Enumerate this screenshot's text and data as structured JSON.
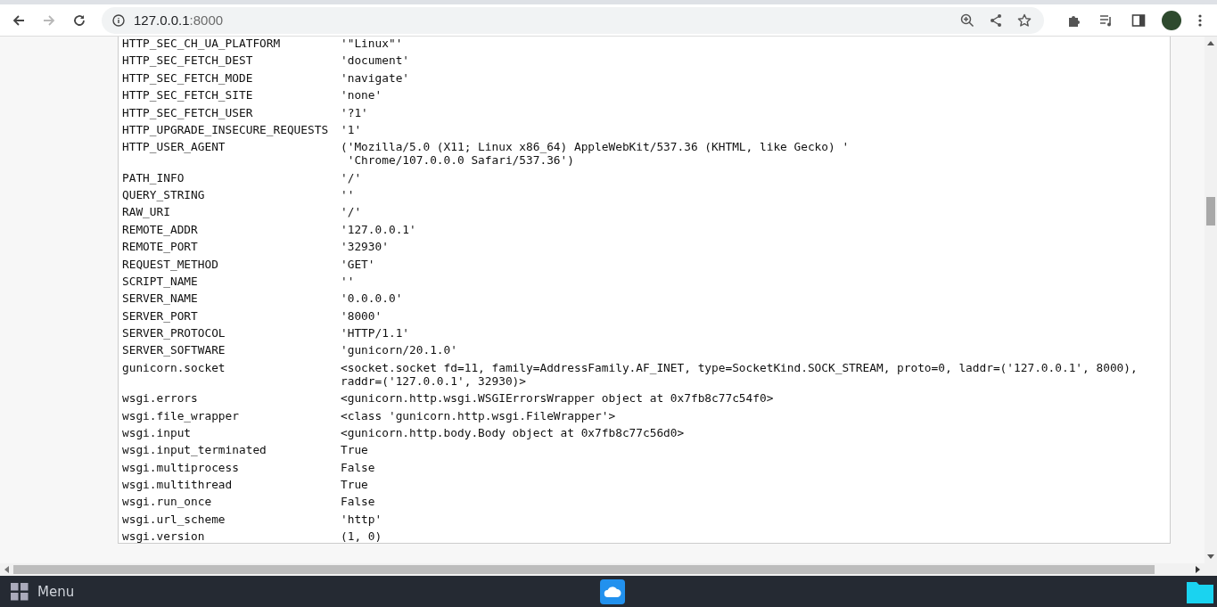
{
  "browser": {
    "url_host": "127.0.0.1",
    "url_port": ":8000",
    "forward_disabled": true
  },
  "environ": [
    {
      "key": "HTTP_SEC_CH_UA_PLATFORM",
      "value": "'\"Linux\"'"
    },
    {
      "key": "HTTP_SEC_FETCH_DEST",
      "value": "'document'"
    },
    {
      "key": "HTTP_SEC_FETCH_MODE",
      "value": "'navigate'"
    },
    {
      "key": "HTTP_SEC_FETCH_SITE",
      "value": "'none'"
    },
    {
      "key": "HTTP_SEC_FETCH_USER",
      "value": "'?1'"
    },
    {
      "key": "HTTP_UPGRADE_INSECURE_REQUESTS",
      "value": "'1'"
    },
    {
      "key": "HTTP_USER_AGENT",
      "value": "('Mozilla/5.0 (X11; Linux x86_64) AppleWebKit/537.36 (KHTML, like Gecko) '\n 'Chrome/107.0.0.0 Safari/537.36')"
    },
    {
      "key": "PATH_INFO",
      "value": "'/'"
    },
    {
      "key": "QUERY_STRING",
      "value": "''"
    },
    {
      "key": "RAW_URI",
      "value": "'/'"
    },
    {
      "key": "REMOTE_ADDR",
      "value": "'127.0.0.1'"
    },
    {
      "key": "REMOTE_PORT",
      "value": "'32930'"
    },
    {
      "key": "REQUEST_METHOD",
      "value": "'GET'"
    },
    {
      "key": "SCRIPT_NAME",
      "value": "''"
    },
    {
      "key": "SERVER_NAME",
      "value": "'0.0.0.0'"
    },
    {
      "key": "SERVER_PORT",
      "value": "'8000'"
    },
    {
      "key": "SERVER_PROTOCOL",
      "value": "'HTTP/1.1'"
    },
    {
      "key": "SERVER_SOFTWARE",
      "value": "'gunicorn/20.1.0'"
    },
    {
      "key": "gunicorn.socket",
      "value": "<socket.socket fd=11, family=AddressFamily.AF_INET, type=SocketKind.SOCK_STREAM, proto=0, laddr=('127.0.0.1', 8000),\nraddr=('127.0.0.1', 32930)>"
    },
    {
      "key": "wsgi.errors",
      "value": "<gunicorn.http.wsgi.WSGIErrorsWrapper object at 0x7fb8c77c54f0>"
    },
    {
      "key": "wsgi.file_wrapper",
      "value": "<class 'gunicorn.http.wsgi.FileWrapper'>"
    },
    {
      "key": "wsgi.input",
      "value": "<gunicorn.http.body.Body object at 0x7fb8c77c56d0>"
    },
    {
      "key": "wsgi.input_terminated",
      "value": "True"
    },
    {
      "key": "wsgi.multiprocess",
      "value": "False"
    },
    {
      "key": "wsgi.multithread",
      "value": "True"
    },
    {
      "key": "wsgi.run_once",
      "value": "False"
    },
    {
      "key": "wsgi.url_scheme",
      "value": "'http'"
    },
    {
      "key": "wsgi.version",
      "value": "(1, 0)"
    }
  ],
  "taskbar": {
    "menu_label": "Menu"
  }
}
